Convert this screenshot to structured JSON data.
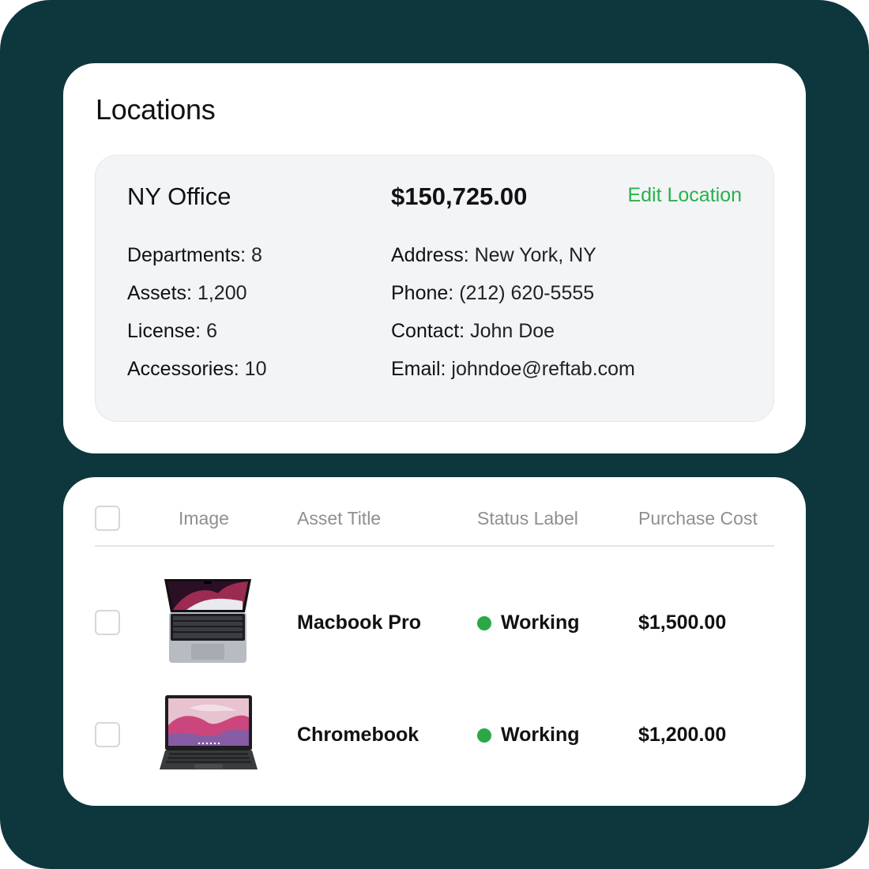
{
  "colors": {
    "frame_bg": "#0e363d",
    "accent_green": "#27b24a",
    "status_working": "#2aa846"
  },
  "locations": {
    "title": "Locations",
    "location": {
      "name": "NY Office",
      "total_cost": "$150,725.00",
      "edit_label": "Edit Location",
      "stats_left": [
        {
          "key": "Departments:",
          "value": "8"
        },
        {
          "key": "Assets:",
          "value": "1,200"
        },
        {
          "key": "License:",
          "value": "6"
        },
        {
          "key": "Accessories:",
          "value": "10"
        }
      ],
      "stats_right": [
        {
          "key": "Address:",
          "value": "New York, NY"
        },
        {
          "key": "Phone:",
          "value": "(212) 620-5555"
        },
        {
          "key": "Contact:",
          "value": "John Doe"
        },
        {
          "key": "Email:",
          "value": "johndoe@reftab.com"
        }
      ]
    }
  },
  "assets_table": {
    "columns": [
      "Image",
      "Asset Title",
      "Status Label",
      "Purchase Cost"
    ],
    "rows": [
      {
        "image_icon": "macbook-pro-image",
        "title": "Macbook Pro",
        "status": "Working",
        "cost": "$1,500.00"
      },
      {
        "image_icon": "chromebook-image",
        "title": "Chromebook",
        "status": "Working",
        "cost": "$1,200.00"
      }
    ]
  }
}
